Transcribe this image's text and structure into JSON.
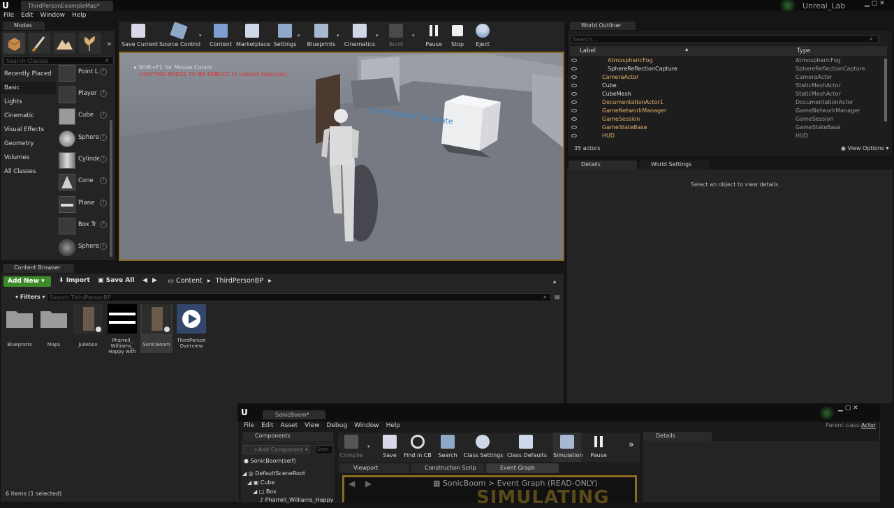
{
  "title_bar": {
    "doc_tab": "ThirdPersonExampleMap*",
    "project_name": "Unreal_Lab"
  },
  "menu": [
    "File",
    "Edit",
    "Window",
    "Help"
  ],
  "modes": {
    "tab_label": "Modes",
    "search_placeholder": "Search Classes",
    "categories": [
      "Recently Placed",
      "Basic",
      "Lights",
      "Cinematic",
      "Visual Effects",
      "Geometry",
      "Volumes",
      "All Classes"
    ],
    "items": [
      "Point L",
      "Player",
      "Cube",
      "Sphere",
      "Cylinde",
      "Cone",
      "Plane",
      "Box Tr",
      "Sphere"
    ]
  },
  "toolbar": [
    "Save Current",
    "Source Control",
    "Content",
    "Marketplace",
    "Settings",
    "Blueprints",
    "Cinematics",
    "Build",
    "Pause",
    "Stop",
    "Eject"
  ],
  "viewport": {
    "hint": "Shift+F1 for Mouse Cursor",
    "warning": "LIGHTING NEEDS TO BE REBUILT (1 unbuilt object(s))",
    "floor_text": "Third Person Template"
  },
  "world_outliner": {
    "tab_label": "World Outliner",
    "search_placeholder": "Search...",
    "col_label": "Label",
    "col_type": "Type",
    "rows": [
      {
        "label": "AtmosphericFog",
        "type": "AtmosphericFog",
        "indent": 1
      },
      {
        "label": "SphereReflectionCapture",
        "type": "SphereReflectionCapture",
        "indent": 1
      },
      {
        "label": "CameraActor",
        "type": "CameraActor",
        "indent": 0
      },
      {
        "label": "Cube",
        "type": "StaticMeshActor",
        "indent": 0
      },
      {
        "label": "CubeMesh",
        "type": "StaticMeshActor",
        "indent": 0
      },
      {
        "label": "DocumentationActor1",
        "type": "DocumentationActor",
        "indent": 0
      },
      {
        "label": "GameNetworkManager",
        "type": "GameNetworkManager",
        "indent": 0
      },
      {
        "label": "GameSession",
        "type": "GameSession",
        "indent": 0
      },
      {
        "label": "GameStateBase",
        "type": "GameStateBase",
        "indent": 0
      },
      {
        "label": "HUD",
        "type": "HUD",
        "indent": 0
      }
    ],
    "count": "35 actors",
    "view_options": "View Options"
  },
  "details": {
    "tab_label": "Details",
    "world_settings_label": "World Settings",
    "empty_message": "Select an object to view details."
  },
  "content_browser": {
    "tab_label": "Content Browser",
    "add_new": "Add New",
    "import": "Import",
    "save_all": "Save All",
    "path": [
      "Content",
      "ThirdPersonBP"
    ],
    "filters": "Filters",
    "search_placeholder": "Search ThirdPersonBP",
    "assets": [
      {
        "label": "Blueprints",
        "kind": "folder"
      },
      {
        "label": "Maps",
        "kind": "folder"
      },
      {
        "label": "Jukebox",
        "kind": "bp"
      },
      {
        "label": "Pharrell_ Williams_ Happy with",
        "kind": "sound"
      },
      {
        "label": "SonicBoom",
        "kind": "bp"
      },
      {
        "label": "ThirdPerson Overview",
        "kind": "doc"
      }
    ],
    "status": "6 items (1 selected)"
  },
  "bp_editor": {
    "tab": "SonicBoom*",
    "menu": [
      "File",
      "Edit",
      "Asset",
      "View",
      "Debug",
      "Window",
      "Help"
    ],
    "parent_class_label": "Parent class:",
    "parent_class": "Actor",
    "components_tab": "Components",
    "add_component": "+Add Component",
    "search_placeholder": "Sear",
    "self_label": "SonicBoom(self)",
    "tree": [
      "DefaultSceneRoot",
      "Cube",
      "Box",
      "Pharrell_Williams_Happy"
    ],
    "toolbar": [
      "Compile",
      "Save",
      "Find in CB",
      "Search",
      "Class Settings",
      "Class Defaults",
      "Simulation",
      "Pause"
    ],
    "tabs": [
      "Viewport",
      "Construction Scrip",
      "Event Graph"
    ],
    "graph_crumb": "SonicBoom  >  Event Graph   (READ-ONLY)",
    "graph_overlay": "SIMULATING",
    "details_tab": "Details"
  }
}
